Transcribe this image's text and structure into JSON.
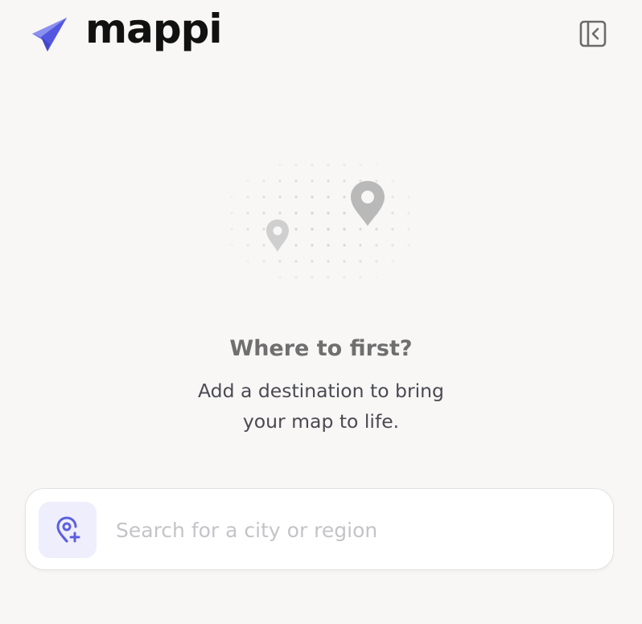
{
  "app": {
    "name": "mappi",
    "brand_color": "#6366f1"
  },
  "header": {
    "collapse_icon": "sidebar-collapse-icon"
  },
  "empty_state": {
    "illustration_icon": "map-pins-icon",
    "title": "Where to first?",
    "description": "Add a destination to bring your map to life."
  },
  "search": {
    "icon": "map-pin-plus-icon",
    "value": "",
    "placeholder": "Search for a city or region"
  }
}
